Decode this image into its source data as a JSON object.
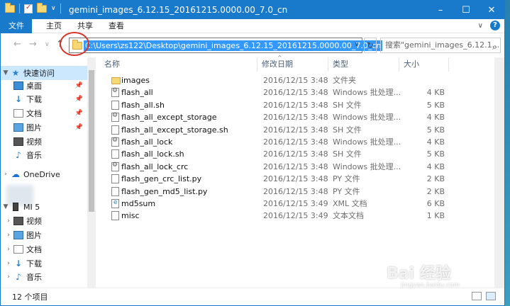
{
  "window": {
    "title": "gemini_images_6.12.15_20161215.0000.00_7.0_cn",
    "controls": [
      "–",
      "☐",
      "✕"
    ]
  },
  "ribbon": {
    "tabs": [
      "文件",
      "主页",
      "共享",
      "查看"
    ],
    "expand_glyph": "∨",
    "help_glyph": "?"
  },
  "address": {
    "path": "C:\\Users\\zs122\\Desktop\\gemini_images_6.12.15_20161215.0000.00_7.0_cn",
    "dropdown_glyph": "∨",
    "refresh_glyph": "↻",
    "search_placeholder": "搜索\"gemini_images_6.12.1...",
    "search_glyph": "⌕"
  },
  "nav_glyphs": {
    "back": "←",
    "forward": "→",
    "recent": "∨",
    "up": "↑"
  },
  "sidebar": {
    "quick_access": "快速访问",
    "items": [
      {
        "label": "桌面",
        "pinned": true
      },
      {
        "label": "下载",
        "pinned": true
      },
      {
        "label": "文档",
        "pinned": true
      },
      {
        "label": "图片",
        "pinned": true
      },
      {
        "label": "视频"
      },
      {
        "label": "音乐"
      }
    ],
    "onedrive": "OneDrive",
    "device": "MI 5",
    "device_items": [
      "视频",
      "图片",
      "文档",
      "下载",
      "音乐"
    ]
  },
  "columns": {
    "name": "名称",
    "date": "修改日期",
    "type": "类型",
    "size": "大小"
  },
  "files": [
    {
      "name": "images",
      "date": "2016/12/15 3:48",
      "type": "文件夹",
      "size": "",
      "icon": "folder"
    },
    {
      "name": "flash_all",
      "date": "2016/12/15 3:48",
      "type": "Windows 批处理...",
      "size": "4 KB",
      "icon": "bat"
    },
    {
      "name": "flash_all.sh",
      "date": "2016/12/15 3:48",
      "type": "SH 文件",
      "size": "5 KB",
      "icon": "doc"
    },
    {
      "name": "flash_all_except_storage",
      "date": "2016/12/15 3:48",
      "type": "Windows 批处理...",
      "size": "4 KB",
      "icon": "bat"
    },
    {
      "name": "flash_all_except_storage.sh",
      "date": "2016/12/15 3:48",
      "type": "SH 文件",
      "size": "5 KB",
      "icon": "doc"
    },
    {
      "name": "flash_all_lock",
      "date": "2016/12/15 3:48",
      "type": "Windows 批处理...",
      "size": "4 KB",
      "icon": "bat"
    },
    {
      "name": "flash_all_lock.sh",
      "date": "2016/12/15 3:48",
      "type": "SH 文件",
      "size": "5 KB",
      "icon": "doc"
    },
    {
      "name": "flash_all_lock_crc",
      "date": "2016/12/15 3:48",
      "type": "Windows 批处理...",
      "size": "4 KB",
      "icon": "bat"
    },
    {
      "name": "flash_gen_crc_list.py",
      "date": "2016/12/15 3:48",
      "type": "PY 文件",
      "size": "2 KB",
      "icon": "doc"
    },
    {
      "name": "flash_gen_md5_list.py",
      "date": "2016/12/15 3:48",
      "type": "PY 文件",
      "size": "2 KB",
      "icon": "doc"
    },
    {
      "name": "md5sum",
      "date": "2016/12/15 3:49",
      "type": "XML 文档",
      "size": "6 KB",
      "icon": "xml"
    },
    {
      "name": "misc",
      "date": "2016/12/15 3:49",
      "type": "文本文档",
      "size": "1 KB",
      "icon": "doc"
    }
  ],
  "status": {
    "item_count": "12 个项目"
  },
  "watermark": {
    "brand": "Bai 经验",
    "url": "jingyan.baidu.com"
  },
  "colors": {
    "accent": "#1979ca",
    "selection": "#3399ff",
    "nav_active": "#cce8ff",
    "annotation_circle": "#d9332a"
  }
}
